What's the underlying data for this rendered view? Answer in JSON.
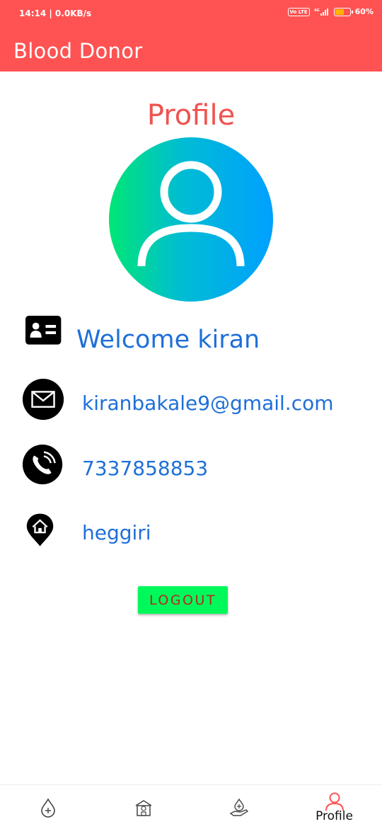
{
  "status": {
    "time": "14:14 | 0.0KB/s",
    "volte": "Vo LTE",
    "network": "4G",
    "battery": "60%"
  },
  "appbar": {
    "title": "Blood Donor",
    "color": "#ff5252"
  },
  "page": {
    "heading": "Profile"
  },
  "profile": {
    "welcome": "Welcome kiran",
    "email": "kiranbakale9@gmail.com",
    "phone": "7337858853",
    "address": "heggiri"
  },
  "actions": {
    "logout_label": "LOGOUT"
  },
  "icons": {
    "avatar": "user-avatar-icon",
    "id_card": "id-card-icon",
    "email": "mail-icon",
    "phone": "phone-icon",
    "location": "home-location-icon"
  },
  "bottom_nav": {
    "items": [
      {
        "icon": "blood-drop-icon",
        "label": ""
      },
      {
        "icon": "hospital-icon",
        "label": ""
      },
      {
        "icon": "donate-hand-icon",
        "label": ""
      },
      {
        "icon": "profile-icon",
        "label": "Profile",
        "active": true
      }
    ]
  }
}
